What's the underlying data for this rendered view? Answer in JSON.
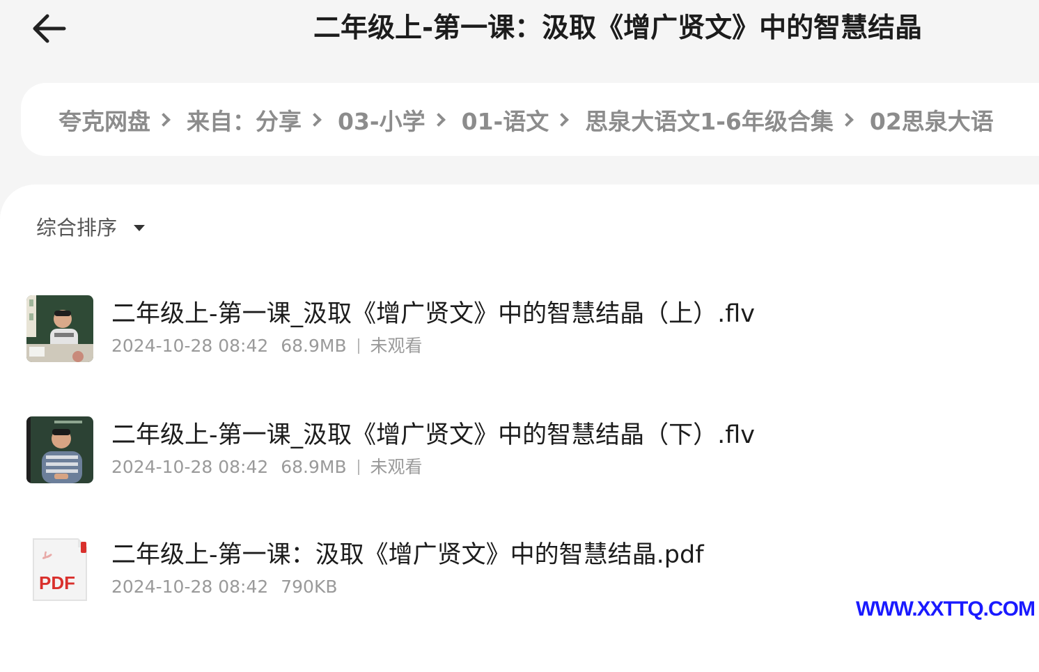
{
  "header": {
    "title": "二年级上-第一课：汲取《增广贤文》中的智慧结晶"
  },
  "breadcrumb": {
    "items": [
      "夸克网盘",
      "来自：分享",
      "03-小学",
      "01-语文",
      "思泉大语文1-6年级合集",
      "02思泉大语"
    ]
  },
  "sort": {
    "label": "综合排序"
  },
  "files": [
    {
      "name": "二年级上-第一课_汲取《增广贤文》中的智慧结晶（上）.flv",
      "date": "2024-10-28 08:42",
      "size": "68.9MB",
      "status": "未观看"
    },
    {
      "name": "二年级上-第一课_汲取《增广贤文》中的智慧结晶（下）.flv",
      "date": "2024-10-28 08:42",
      "size": "68.9MB",
      "status": "未观看"
    },
    {
      "name": "二年级上-第一课：汲取《增广贤文》中的智慧结晶.pdf",
      "date": "2024-10-28 08:42",
      "size": "790KB",
      "badge": "PDF"
    }
  ],
  "watermark": "WWW.XXTTQ.COM",
  "colors": {
    "background": "#f5f5f5",
    "surface": "#ffffff",
    "pdf_red": "#d9302c",
    "watermark_blue": "#1a1aff"
  }
}
